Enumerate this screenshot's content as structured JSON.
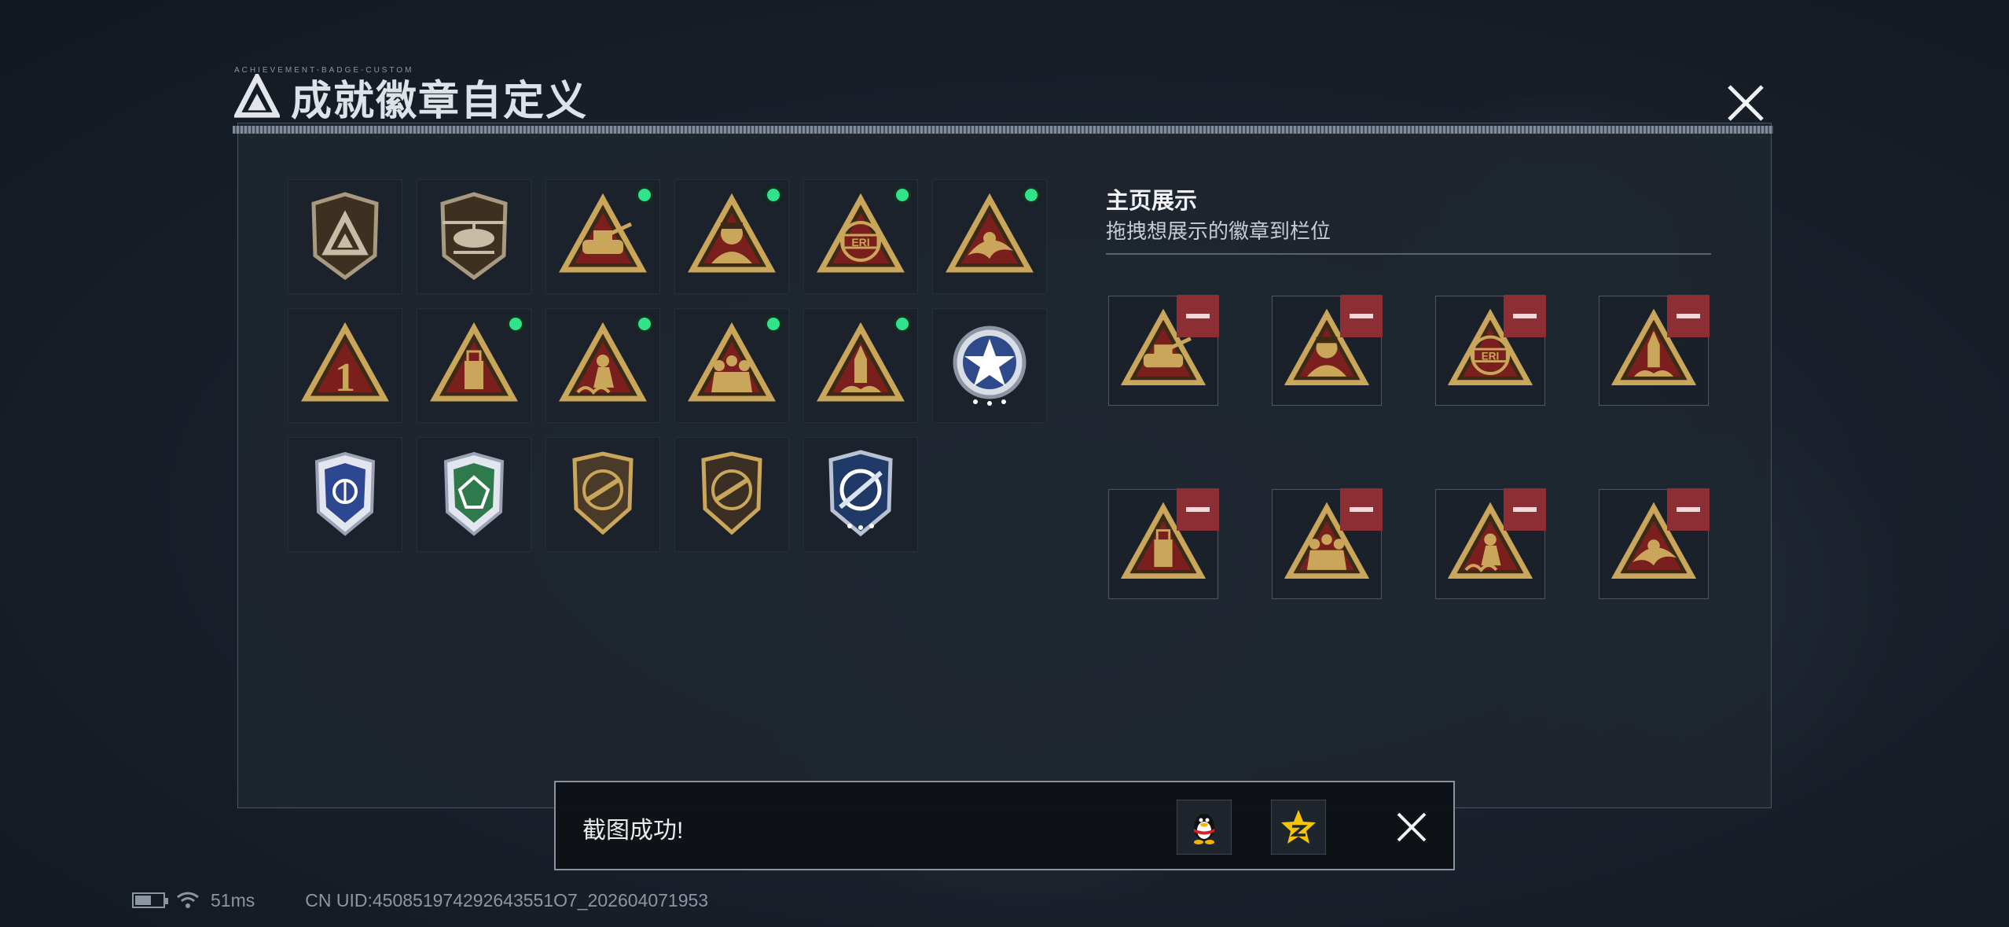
{
  "window": {
    "title": "成就徽章自定义",
    "title_deco": "ACHIEVEMENT-BADGE-CUSTOM"
  },
  "display": {
    "title": "主页展示",
    "subtitle": "拖拽想展示的徽章到栏位"
  },
  "badges": [
    {
      "icon": "shield-logo-badge-icon",
      "new": false
    },
    {
      "icon": "helicopter-shield-badge-icon",
      "new": false
    },
    {
      "icon": "tank-triangle-badge-icon",
      "new": true
    },
    {
      "icon": "soldier-bust-triangle-badge-icon",
      "new": true
    },
    {
      "icon": "eri-globe-triangle-badge-icon",
      "new": true
    },
    {
      "icon": "hand-triangle-badge-icon",
      "new": true
    },
    {
      "icon": "number-one-triangle-badge-icon",
      "new": false
    },
    {
      "icon": "usb-triangle-badge-icon",
      "new": true
    },
    {
      "icon": "fighter-wave-triangle-badge-icon",
      "new": true
    },
    {
      "icon": "squad-triangle-badge-icon",
      "new": true
    },
    {
      "icon": "rocket-triangle-badge-icon",
      "new": true
    },
    {
      "icon": "star-wreath-badge-icon",
      "new": false
    },
    {
      "icon": "blue-shield-badge-icon",
      "new": false
    },
    {
      "icon": "green-shield-badge-icon",
      "new": false
    },
    {
      "icon": "rifle-shield-badge-icon",
      "new": false
    },
    {
      "icon": "rifle-shield-dark-badge-icon",
      "new": false
    },
    {
      "icon": "crosshair-shield-badge-icon",
      "new": false
    }
  ],
  "display_slots": [
    {
      "icon": "tank-triangle-badge-icon"
    },
    {
      "icon": "soldier-bust-triangle-badge-icon"
    },
    {
      "icon": "eri-globe-triangle-badge-icon"
    },
    {
      "icon": "rocket-triangle-badge-icon"
    },
    {
      "icon": "usb-triangle-badge-icon"
    },
    {
      "icon": "squad-triangle-badge-icon"
    },
    {
      "icon": "fighter-wave-triangle-badge-icon"
    },
    {
      "icon": "hand-triangle-badge-icon"
    }
  ],
  "toast": {
    "message": "截图成功!",
    "share_qq_icon": "qq-penguin-icon",
    "share_qzone_icon": "qzone-star-icon"
  },
  "status_bar": {
    "ping": "51ms",
    "uid": "CN UID:450851974292643551O7_202604071953"
  },
  "colors": {
    "accent_new": "#2fe38b",
    "remove": "#8c2e33",
    "badge_gold": "#c9a65a",
    "badge_red": "#7a1f1d"
  }
}
